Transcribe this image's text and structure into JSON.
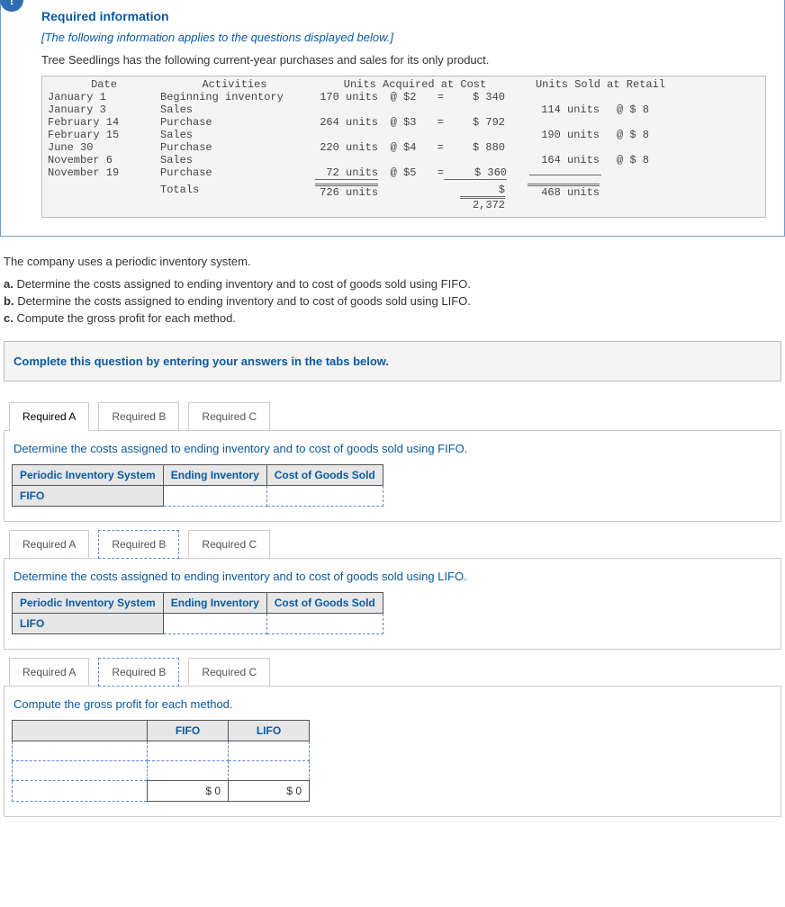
{
  "header": {
    "badge": "!",
    "title": "Required information",
    "italic": "[The following information applies to the questions displayed below.]",
    "intro": "Tree Seedlings has the following current-year purchases and sales for its only product."
  },
  "tableHeaders": {
    "date": "Date",
    "activities": "Activities",
    "acquired": "Units Acquired at Cost",
    "sold": "Units Sold at Retail"
  },
  "rows": [
    {
      "date": "January 1",
      "activity": "Beginning inventory",
      "units": "170 units",
      "at": "@ $2",
      "eq": "=",
      "cost": "$ 340",
      "sold": "",
      "price": ""
    },
    {
      "date": "January 3",
      "activity": "Sales",
      "units": "",
      "at": "",
      "eq": "",
      "cost": "",
      "sold": "114 units",
      "price": "@ $ 8"
    },
    {
      "date": "February 14",
      "activity": "Purchase",
      "units": "264 units",
      "at": "@ $3",
      "eq": "=",
      "cost": "$ 792",
      "sold": "",
      "price": ""
    },
    {
      "date": "February 15",
      "activity": "Sales",
      "units": "",
      "at": "",
      "eq": "",
      "cost": "",
      "sold": "190 units",
      "price": "@ $ 8"
    },
    {
      "date": "June 30",
      "activity": "Purchase",
      "units": "220 units",
      "at": "@ $4",
      "eq": "=",
      "cost": "$ 880",
      "sold": "",
      "price": ""
    },
    {
      "date": "November 6",
      "activity": "Sales",
      "units": "",
      "at": "",
      "eq": "",
      "cost": "",
      "sold": "164 units",
      "price": "@ $ 8"
    },
    {
      "date": "November 19",
      "activity": "Purchase",
      "units": "72 units",
      "at": "@ $5",
      "eq": "=",
      "cost": "$ 360",
      "sold": "",
      "price": ""
    }
  ],
  "totals": {
    "label": "Totals",
    "units": "726 units",
    "cost_top": "$",
    "cost": "2,372",
    "sold": "468 units"
  },
  "body": {
    "periodic": "The company uses a periodic inventory system.",
    "a_label": "a.",
    "a": "Determine the costs assigned to ending inventory and to cost of goods sold using FIFO.",
    "b_label": "b.",
    "b": "Determine the costs assigned to ending inventory and to cost of goods sold using LIFO.",
    "c_label": "c.",
    "c": "Compute the gross profit for each method.",
    "instr": "Complete this question by entering your answers in the tabs below."
  },
  "tabs": {
    "a": "Required A",
    "b": "Required B",
    "c": "Required C"
  },
  "sectionA": {
    "instr": "Determine the costs assigned to ending inventory and to cost of goods sold using FIFO.",
    "h1": "Periodic Inventory System",
    "h2": "Ending Inventory",
    "h3": "Cost of Goods Sold",
    "rowlabel": "FIFO"
  },
  "sectionB": {
    "instr": "Determine the costs assigned to ending inventory and to cost of goods sold using LIFO.",
    "h1": "Periodic Inventory System",
    "h2": "Ending Inventory",
    "h3": "Cost of Goods Sold",
    "rowlabel": "LIFO"
  },
  "sectionC": {
    "instr": "Compute the gross profit for each method.",
    "h1": "FIFO",
    "h2": "LIFO",
    "val1": "$          0",
    "val2": "$          0"
  }
}
